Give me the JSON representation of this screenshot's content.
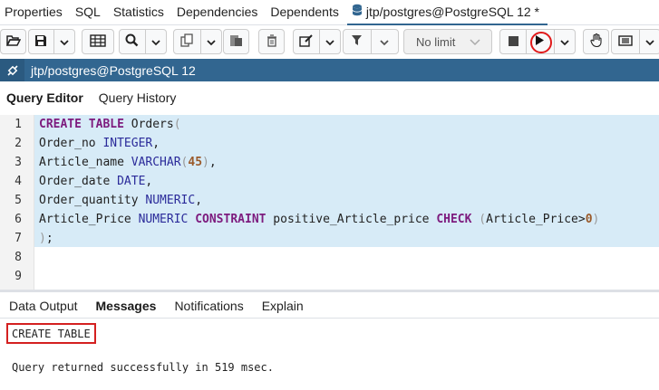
{
  "top_tabs": {
    "items": [
      {
        "label": "Properties"
      },
      {
        "label": "SQL"
      },
      {
        "label": "Statistics"
      },
      {
        "label": "Dependencies"
      },
      {
        "label": "Dependents"
      }
    ],
    "active_label": "jtp/postgres@PostgreSQL 12 *"
  },
  "toolbar": {
    "limit_value": "No limit",
    "icons": [
      "open-file-icon",
      "save-icon",
      "chevron-down-icon",
      "grid-icon",
      "search-icon",
      "chevron-down-icon",
      "copy-icon",
      "chevron-down-icon",
      "paste-icon",
      "delete-icon",
      "edit-icon",
      "chevron-down-icon",
      "filter-icon",
      "chevron-down-icon",
      "stop-icon",
      "play-icon",
      "chevron-down-icon",
      "hand-icon",
      "macro-icon",
      "chevron-down-icon"
    ]
  },
  "connection": {
    "label": "jtp/postgres@PostgreSQL 12"
  },
  "editor_tabs": {
    "query_editor": "Query Editor",
    "query_history": "Query History"
  },
  "editor": {
    "line_numbers": [
      "1",
      "2",
      "3",
      "4",
      "5",
      "6",
      "7",
      "8",
      "9"
    ],
    "lines": [
      [
        {
          "t": "kw",
          "v": "CREATE TABLE"
        },
        {
          "t": "p",
          "v": " Orders"
        },
        {
          "t": "pn",
          "v": "("
        }
      ],
      [
        {
          "t": "p",
          "v": "Order_no "
        },
        {
          "t": "ty",
          "v": "INTEGER"
        },
        {
          "t": "p",
          "v": ","
        }
      ],
      [
        {
          "t": "p",
          "v": "Article_name "
        },
        {
          "t": "ty",
          "v": "VARCHAR"
        },
        {
          "t": "pn",
          "v": "("
        },
        {
          "t": "num",
          "v": "45"
        },
        {
          "t": "pn",
          "v": ")"
        },
        {
          "t": "p",
          "v": ","
        }
      ],
      [
        {
          "t": "p",
          "v": "Order_date "
        },
        {
          "t": "ty",
          "v": "DATE"
        },
        {
          "t": "p",
          "v": ","
        }
      ],
      [
        {
          "t": "p",
          "v": "Order_quantity "
        },
        {
          "t": "ty",
          "v": "NUMERIC"
        },
        {
          "t": "p",
          "v": ","
        }
      ],
      [
        {
          "t": "p",
          "v": "Article_Price "
        },
        {
          "t": "ty",
          "v": "NUMERIC"
        },
        {
          "t": "p",
          "v": " "
        },
        {
          "t": "kw",
          "v": "CONSTRAINT"
        },
        {
          "t": "p",
          "v": " positive_Article_price "
        },
        {
          "t": "kw",
          "v": "CHECK"
        },
        {
          "t": "p",
          "v": " "
        },
        {
          "t": "pn",
          "v": "("
        },
        {
          "t": "p",
          "v": "Article_Price>"
        },
        {
          "t": "num",
          "v": "0"
        },
        {
          "t": "pn",
          "v": ")"
        }
      ],
      [
        {
          "t": "pn",
          "v": ")"
        },
        {
          "t": "p",
          "v": ";"
        }
      ],
      [],
      []
    ]
  },
  "result_tabs": {
    "data_output": "Data Output",
    "messages": "Messages",
    "notifications": "Notifications",
    "explain": "Explain"
  },
  "messages": {
    "result_label": "CREATE TABLE",
    "status_text": "Query returned successfully in 519 msec."
  },
  "colors": {
    "connection_bar": "#326690",
    "selection": "#d7ebf7",
    "keyword": "#7d1b7e",
    "type": "#2b2b9a",
    "highlight_box": "#d42020"
  }
}
